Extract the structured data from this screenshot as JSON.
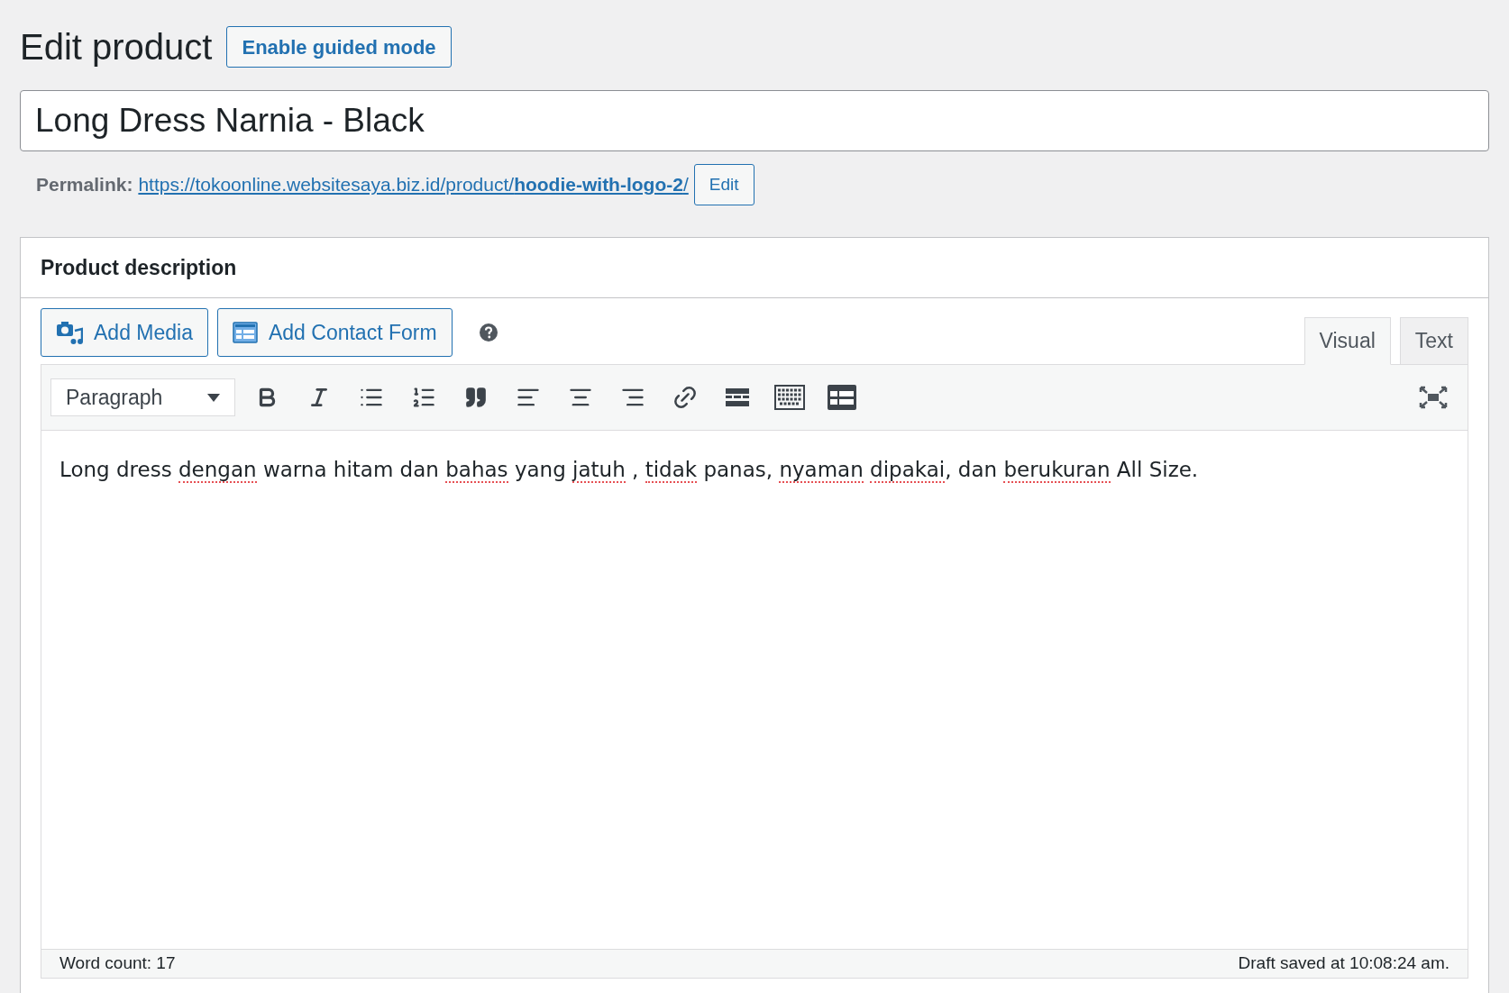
{
  "heading": "Edit product",
  "guided_button": "Enable guided mode",
  "title_field": {
    "value": "Long Dress Narnia - Black"
  },
  "permalink": {
    "label": "Permalink:",
    "url_base": "https://tokoonline.websitesaya.biz.id/product/",
    "slug": "hoodie-with-logo-2",
    "url_end": "/",
    "edit_button": "Edit"
  },
  "panel": {
    "title": "Product description"
  },
  "media_buttons": [
    {
      "label": "Add Media",
      "kind": "media"
    },
    {
      "label": "Add Contact Form",
      "kind": "form"
    }
  ],
  "editor_tabs": [
    {
      "label": "Visual",
      "selected": true
    },
    {
      "label": "Text",
      "selected": false
    }
  ],
  "format_select": {
    "value": "Paragraph"
  },
  "content": [
    {
      "text": "Long dress ",
      "misspelled": false
    },
    {
      "text": "dengan",
      "misspelled": true
    },
    {
      "text": " warna hitam dan ",
      "misspelled": false
    },
    {
      "text": "bahas",
      "misspelled": true
    },
    {
      "text": " yang ",
      "misspelled": false
    },
    {
      "text": "jatuh",
      "misspelled": true
    },
    {
      "text": " , ",
      "misspelled": false
    },
    {
      "text": "tidak",
      "misspelled": true
    },
    {
      "text": " panas, ",
      "misspelled": false
    },
    {
      "text": "nyaman",
      "misspelled": true
    },
    {
      "text": " dipakai",
      "misspelled": true
    },
    {
      "text": ", dan ",
      "misspelled": false
    },
    {
      "text": "berukuran",
      "misspelled": true
    },
    {
      "text": " All Size.",
      "misspelled": false
    }
  ],
  "status_bar": {
    "word_count": "Word count: 17",
    "draft_saved": "Draft saved at 10:08:24 am."
  }
}
